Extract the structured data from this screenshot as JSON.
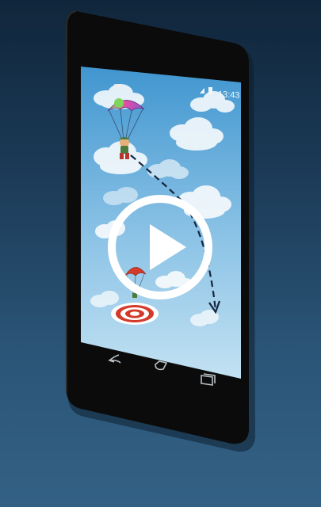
{
  "status_bar": {
    "time": "13:43"
  },
  "video": {
    "play_icon": "play-icon"
  },
  "nav_bar": {
    "back_icon": "back-icon",
    "home_icon": "home-icon",
    "recents_icon": "recents-icon"
  },
  "colors": {
    "background_top": "#10263b",
    "background_bottom": "#336185",
    "phone_body": "#0b0b0b",
    "screen_sky_top": "#3f95cf",
    "screen_sky_bottom": "#bfe0f0",
    "play_overlay": "#ffffff"
  }
}
